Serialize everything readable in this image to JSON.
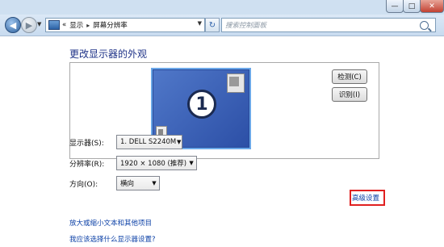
{
  "window": {
    "caption_min": "—",
    "caption_max": "□",
    "caption_close": "✕"
  },
  "nav": {
    "back_glyph": "◀",
    "forward_glyph": "▶",
    "dropdown_glyph": "▼",
    "breadcrumb": [
      "«",
      "显示",
      "屏幕分辨率"
    ],
    "breadcrumb_sep": "▸",
    "refresh_glyph": "↻",
    "search_placeholder": "搜索控制面板"
  },
  "main": {
    "heading": "更改显示器的外观",
    "monitor_number": "1",
    "detect_button": "检测(C)",
    "identify_button": "识别(I)",
    "display_label": "显示器(S):",
    "display_value": "1. DELL S2240M",
    "resolution_label": "分辨率(R):",
    "resolution_value": "1920 × 1080 (推荐)",
    "orientation_label": "方向(O):",
    "orientation_value": "横向",
    "advanced_settings_link": "高级设置",
    "link_text_size": "放大或缩小文本和其他项目",
    "link_which_settings": "我应该选择什么显示器设置?"
  },
  "colors": {
    "highlight_box": "#e02020",
    "link": "#0a3fa6",
    "heading": "#1e3287"
  }
}
